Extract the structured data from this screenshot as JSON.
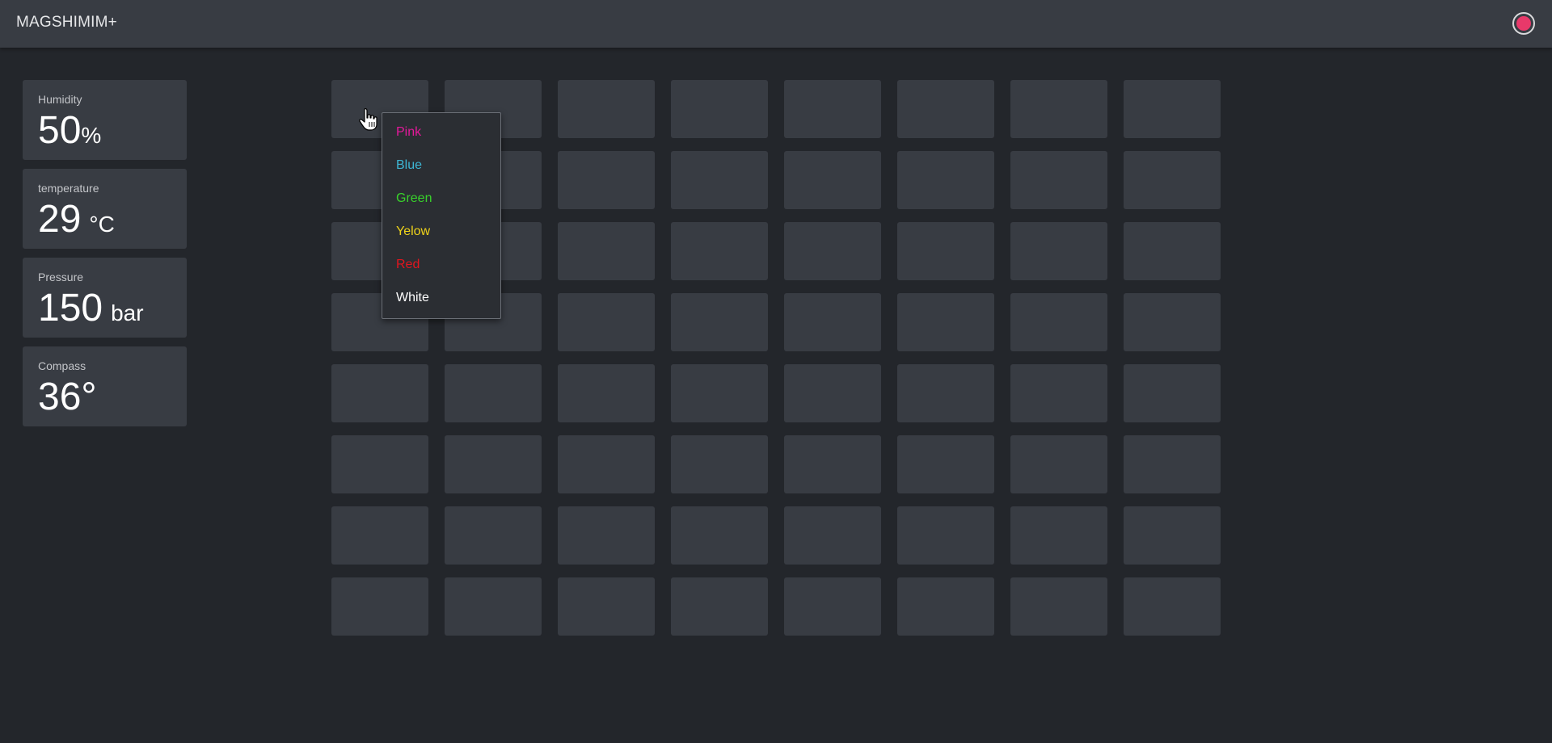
{
  "app": {
    "title": "MAGSHIMIM+"
  },
  "header": {
    "record_icon": "record-icon",
    "record_color": "#e8396a"
  },
  "sensors": [
    {
      "label": "Humidity",
      "value": "50",
      "unit": "%"
    },
    {
      "label": "temperature",
      "value": "29",
      "unit": "°C"
    },
    {
      "label": "Pressure",
      "value": "150",
      "unit": "bar"
    },
    {
      "label": "Compass",
      "value": "36°",
      "unit": ""
    }
  ],
  "grid": {
    "rows": 8,
    "cols": 8
  },
  "color_menu": {
    "items": [
      {
        "label": "Pink",
        "color": "#e5189b"
      },
      {
        "label": "Blue",
        "color": "#3db6d4"
      },
      {
        "label": "Green",
        "color": "#38d12b"
      },
      {
        "label": "Yelow",
        "color": "#eed21a"
      },
      {
        "label": "Red",
        "color": "#e2151e"
      },
      {
        "label": "White",
        "color": "#ffffff"
      }
    ]
  },
  "cursor_icon": "hand-pointer-icon"
}
